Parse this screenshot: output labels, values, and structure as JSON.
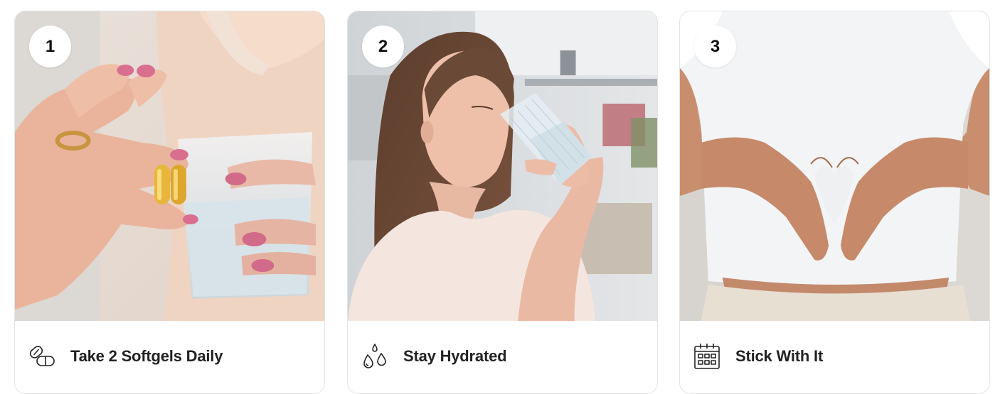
{
  "cards": [
    {
      "step": "1",
      "title": "Take 2 Softgels Daily",
      "icon": "capsule-pill-icon",
      "photo": "hand-holding-softgels-photo"
    },
    {
      "step": "2",
      "title": "Stay Hydrated",
      "icon": "water-drops-icon",
      "photo": "woman-drinking-water-photo"
    },
    {
      "step": "3",
      "title": "Stick With It",
      "icon": "calendar-icon",
      "photo": "hands-heart-on-belly-photo"
    }
  ]
}
